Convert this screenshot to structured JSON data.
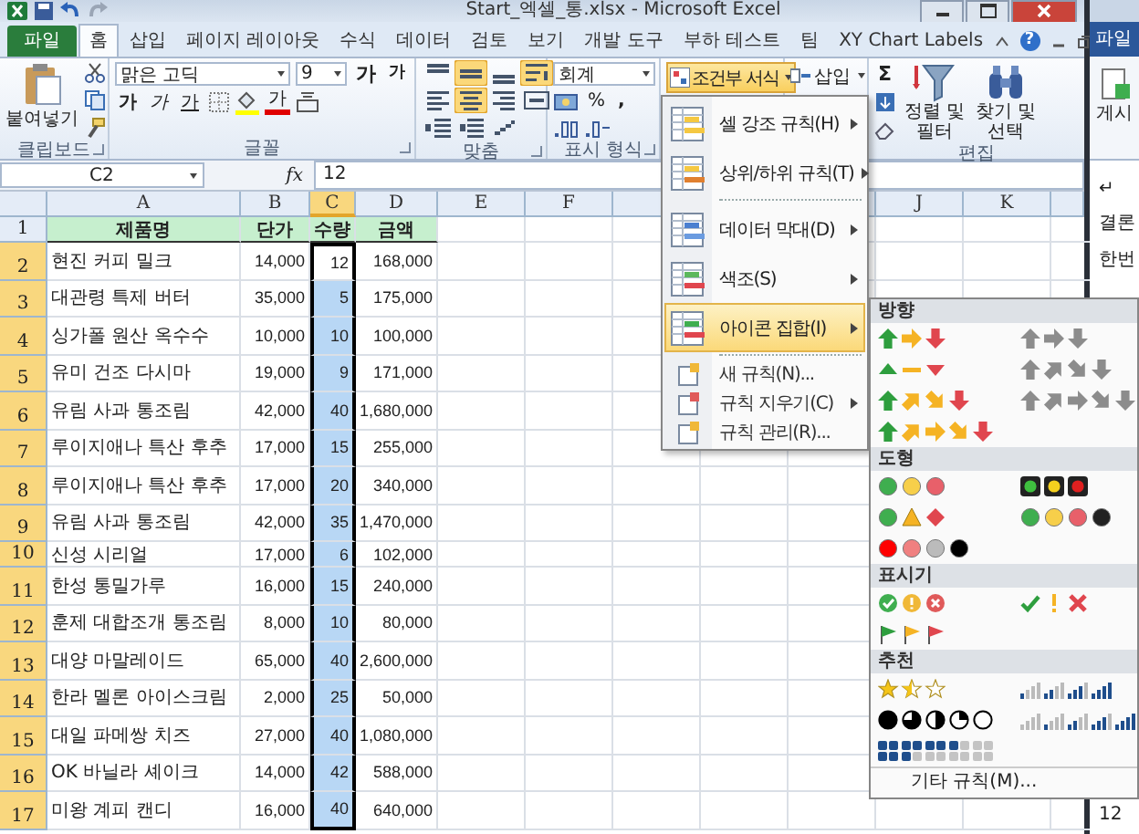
{
  "window": {
    "title": "Start_엑셀_통.xlsx - Microsoft Excel"
  },
  "tabs": [
    {
      "label": "파일",
      "kind": "file",
      "selected": false
    },
    {
      "label": "홈",
      "kind": "tab",
      "selected": true
    },
    {
      "label": "삽입",
      "kind": "tab",
      "selected": false
    },
    {
      "label": "페이지 레이아웃",
      "kind": "tab",
      "selected": false
    },
    {
      "label": "수식",
      "kind": "tab",
      "selected": false
    },
    {
      "label": "데이터",
      "kind": "tab",
      "selected": false
    },
    {
      "label": "검토",
      "kind": "tab",
      "selected": false
    },
    {
      "label": "보기",
      "kind": "tab",
      "selected": false
    },
    {
      "label": "개발 도구",
      "kind": "tab",
      "selected": false
    },
    {
      "label": "부하 테스트",
      "kind": "tab",
      "selected": false
    },
    {
      "label": "팀",
      "kind": "tab",
      "selected": false
    },
    {
      "label": "XY Chart Labels",
      "kind": "tab",
      "selected": false
    }
  ],
  "help": "?",
  "ribbon": {
    "clipboard": {
      "paste": "붙여넣기",
      "group": "클립보드"
    },
    "font": {
      "name": "맑은 고딕",
      "size": "9",
      "grow": "가",
      "shrink": "가",
      "bold": "가",
      "italic": "가",
      "underline": "가",
      "font_color_button": "가",
      "group": "글꼴"
    },
    "alignment": {
      "group": "맞춤",
      "buttons": [
        {
          "selected": false
        },
        {
          "selected": true
        },
        {
          "selected": false
        },
        {
          "selected": true
        },
        {
          "selected": false
        },
        {
          "selected": true
        },
        {
          "selected": false
        },
        {
          "selected": false
        },
        {
          "selected": false
        },
        {
          "selected": false
        },
        {
          "selected": false
        }
      ]
    },
    "number": {
      "format": "회계",
      "percent": "%",
      "comma": ",",
      "group": "표시 형식"
    },
    "conditional_formatting": {
      "label": "조건부 서식",
      "selected": true
    },
    "cells": {
      "insert": "삽입"
    },
    "editing": {
      "sum": "Σ",
      "sort_filter": "정렬 및 필터",
      "find_select": "찾기 및 선택",
      "group": "편집"
    }
  },
  "formula_bar": {
    "name_box": "C2",
    "function_label": "fx",
    "value": "12"
  },
  "sheet": {
    "columns": [
      {
        "label": "A",
        "selected": false
      },
      {
        "label": "B",
        "selected": false
      },
      {
        "label": "C",
        "selected": true
      },
      {
        "label": "D",
        "selected": false
      },
      {
        "label": "E",
        "selected": false
      },
      {
        "label": "F",
        "selected": false
      }
    ],
    "columns_right": [
      {
        "label": "J",
        "selected": false
      },
      {
        "label": "K",
        "selected": false
      }
    ],
    "header_row": {
      "number": "1",
      "cells": [
        "제품명",
        "단가",
        "수량",
        "금액"
      ]
    },
    "rows": [
      {
        "number": "2",
        "selected": true,
        "active": true,
        "compact": false,
        "cells": [
          "현진 커피 밀크",
          "14,000",
          "12",
          "168,000"
        ]
      },
      {
        "number": "3",
        "selected": true,
        "active": false,
        "compact": false,
        "cells": [
          "대관령 특제 버터",
          "35,000",
          "5",
          "175,000"
        ]
      },
      {
        "number": "4",
        "selected": true,
        "active": false,
        "compact": false,
        "cells": [
          "싱가폴 원산 옥수수",
          "10,000",
          "10",
          "100,000"
        ]
      },
      {
        "number": "5",
        "selected": true,
        "active": false,
        "compact": false,
        "cells": [
          "유미 건조 다시마",
          "19,000",
          "9",
          "171,000"
        ]
      },
      {
        "number": "6",
        "selected": true,
        "active": false,
        "compact": false,
        "cells": [
          "유림 사과 통조림",
          "42,000",
          "40",
          "1,680,000"
        ]
      },
      {
        "number": "7",
        "selected": true,
        "active": false,
        "compact": false,
        "cells": [
          "루이지애나 특산 후추",
          "17,000",
          "15",
          "255,000"
        ]
      },
      {
        "number": "8",
        "selected": true,
        "active": false,
        "compact": false,
        "cells": [
          "루이지애나 특산 후추",
          "17,000",
          "20",
          "340,000"
        ]
      },
      {
        "number": "9",
        "selected": true,
        "active": false,
        "compact": false,
        "cells": [
          "유림 사과 통조림",
          "42,000",
          "35",
          "1,470,000"
        ]
      },
      {
        "number": "10",
        "selected": true,
        "active": false,
        "compact": true,
        "cells": [
          "신성 시리얼",
          "17,000",
          "6",
          "102,000"
        ]
      },
      {
        "number": "11",
        "selected": true,
        "active": false,
        "compact": false,
        "cells": [
          "한성 통밀가루",
          "16,000",
          "15",
          "240,000"
        ]
      },
      {
        "number": "12",
        "selected": true,
        "active": false,
        "compact": false,
        "cells": [
          "훈제 대합조개 통조림",
          "8,000",
          "10",
          "80,000"
        ]
      },
      {
        "number": "13",
        "selected": true,
        "active": false,
        "compact": false,
        "cells": [
          "대양 마말레이드",
          "65,000",
          "40",
          "2,600,000"
        ]
      },
      {
        "number": "14",
        "selected": true,
        "active": false,
        "compact": false,
        "cells": [
          "한라 멜론 아이스크림",
          "2,000",
          "25",
          "50,000"
        ]
      },
      {
        "number": "15",
        "selected": true,
        "active": false,
        "compact": false,
        "cells": [
          "대일 파메쌍 치즈",
          "27,000",
          "40",
          "1,080,000"
        ]
      },
      {
        "number": "16",
        "selected": true,
        "active": false,
        "compact": false,
        "cells": [
          "OK 바닐라 셰이크",
          "14,000",
          "42",
          "588,000"
        ]
      },
      {
        "number": "17",
        "selected": true,
        "active": false,
        "compact": false,
        "cells": [
          "미왕 계피 캔디",
          "16,000",
          "40",
          "640,000"
        ]
      }
    ]
  },
  "menu": {
    "items": [
      {
        "kind": "large",
        "label": "셀 강조 규칙(H)",
        "submenu": true,
        "selected": false
      },
      {
        "kind": "large",
        "label": "상위/하위 규칙(T)",
        "submenu": true,
        "selected": false
      },
      {
        "kind": "separator"
      },
      {
        "kind": "large",
        "label": "데이터 막대(D)",
        "submenu": true,
        "selected": false
      },
      {
        "kind": "large",
        "label": "색조(S)",
        "submenu": true,
        "selected": false
      },
      {
        "kind": "large",
        "label": "아이콘 집합(I)",
        "submenu": true,
        "selected": true
      },
      {
        "kind": "separator"
      },
      {
        "kind": "small",
        "label": "새 규칙(N)...",
        "submenu": false,
        "selected": false
      },
      {
        "kind": "small",
        "label": "규칙 지우기(C)",
        "submenu": true,
        "selected": false
      },
      {
        "kind": "small",
        "label": "규칙 관리(R)...",
        "submenu": false,
        "selected": false
      }
    ]
  },
  "icon_sets": {
    "sections": [
      {
        "title": "방향",
        "sets": [
          {
            "kind": "arrows3"
          },
          {
            "kind": "arrows3gray"
          },
          {
            "kind": "triangles3"
          },
          {
            "kind": "arrows4gray"
          },
          {
            "kind": "arrows4"
          },
          {
            "kind": "arrows5gray"
          },
          {
            "kind": "arrows5"
          }
        ]
      },
      {
        "title": "도형",
        "sets": [
          {
            "kind": "circles3"
          },
          {
            "kind": "lights3"
          },
          {
            "kind": "signs3"
          },
          {
            "kind": "lights4"
          },
          {
            "kind": "redblack4"
          }
        ]
      },
      {
        "title": "표시기",
        "sets": [
          {
            "kind": "symbols3c"
          },
          {
            "kind": "symbols3"
          },
          {
            "kind": "flags3"
          }
        ]
      },
      {
        "title": "추천",
        "sets": [
          {
            "kind": "stars3"
          },
          {
            "kind": "ratings4"
          },
          {
            "kind": "quarters5"
          },
          {
            "kind": "ratings5"
          },
          {
            "kind": "boxes5"
          }
        ]
      }
    ],
    "more": "기타 규칙(M)..."
  },
  "side_window": {
    "tab": "파일",
    "button": "게시",
    "lines": [
      "↵",
      "결론",
      "한번"
    ],
    "footer": "12"
  }
}
